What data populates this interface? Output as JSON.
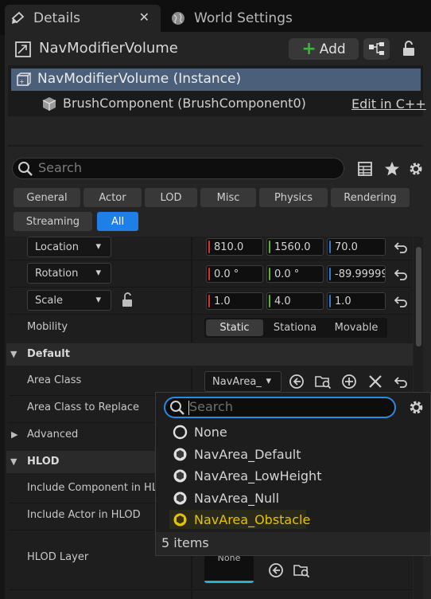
{
  "tabs": {
    "details": "Details",
    "close": "✕",
    "world_settings": "World Settings"
  },
  "header": {
    "title": "NavModifierVolume",
    "add_label": "Add"
  },
  "tree": {
    "instance": "NavModifierVolume (Instance)",
    "component": "BrushComponent (BrushComponent0)",
    "edit_cpp": "Edit in C++"
  },
  "search": {
    "placeholder": "Search"
  },
  "filters": [
    "General",
    "Actor",
    "LOD",
    "Misc",
    "Physics",
    "Rendering",
    "Streaming",
    "All"
  ],
  "active_filter": "All",
  "transform": {
    "location": {
      "label": "Location",
      "x": "810.0",
      "y": "1560.0",
      "z": "70.0"
    },
    "rotation": {
      "label": "Rotation",
      "x": "0.0 °",
      "y": "0.0 °",
      "z": "-89.99999"
    },
    "scale": {
      "label": "Scale",
      "x": "1.0",
      "y": "4.0",
      "z": "1.0"
    }
  },
  "mobility": {
    "label": "Mobility",
    "options": [
      "Static",
      "Stationa",
      "Movable"
    ],
    "selected": "Static"
  },
  "default_section": {
    "title": "Default",
    "area_class_label": "Area Class",
    "area_class_value": "NavArea_",
    "area_class_replace_label": "Area Class to Replace",
    "advanced_label": "Advanced"
  },
  "hlod_section": {
    "title": "HLOD",
    "include_component": "Include Component in HLOD",
    "include_actor": "Include Actor in HLOD",
    "hlod_layer": "HLOD Layer",
    "hlod_layer_value": "None"
  },
  "popup": {
    "search_placeholder": "Search",
    "items": [
      "None",
      "NavArea_Default",
      "NavArea_LowHeight",
      "NavArea_Null",
      "NavArea_Obstacle"
    ],
    "highlighted": "NavArea_Obstacle",
    "count": "5 items"
  },
  "colors": {
    "accent": "#1f7fe8",
    "highlight": "#e6c200",
    "x_axis": "#d9322c",
    "y_axis": "#5fb32c",
    "z_axis": "#2a7bd6"
  }
}
